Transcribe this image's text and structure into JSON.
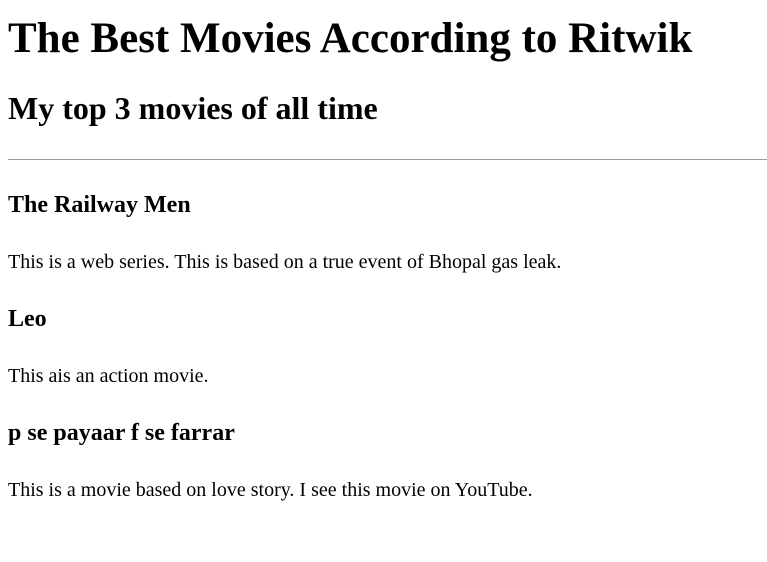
{
  "page": {
    "title": "The Best Movies According to Ritwik",
    "subtitle": "My top 3 movies of all time"
  },
  "movies": [
    {
      "title": "The Railway Men",
      "description": "This is a web series. This is based on a true event of Bhopal gas leak."
    },
    {
      "title": "Leo",
      "description": "This ais an action movie."
    },
    {
      "title": "p se payaar f se farrar",
      "description": "This is a movie based on love story. I see this movie on YouTube."
    }
  ]
}
